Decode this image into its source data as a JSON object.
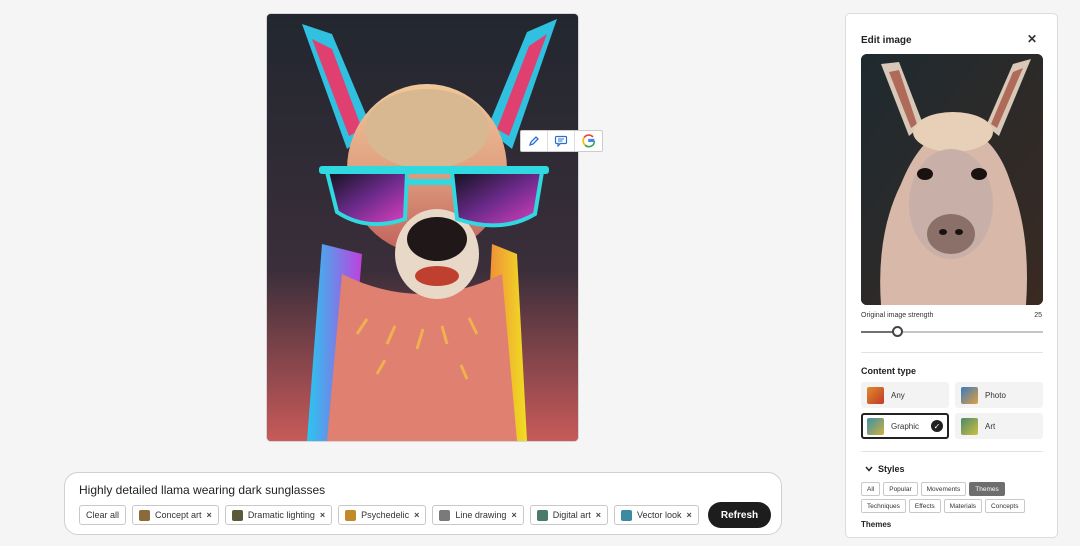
{
  "floating_toolbar": {
    "icons": [
      "pencil-icon",
      "comment-icon",
      "google-icon"
    ]
  },
  "prompt": {
    "text": "Highly detailed llama wearing dark sunglasses",
    "clear_label": "Clear all",
    "chips": [
      {
        "label": "Concept art",
        "thumb_color": "#8a6a3a"
      },
      {
        "label": "Dramatic lighting",
        "thumb_color": "#5a5a3a"
      },
      {
        "label": "Psychedelic",
        "thumb_color": "#c08a2a"
      },
      {
        "label": "Line drawing",
        "thumb_color": "#7a7a7a"
      },
      {
        "label": "Digital art",
        "thumb_color": "#4a7a6a"
      },
      {
        "label": "Vector look",
        "thumb_color": "#3a8aa0"
      }
    ],
    "refresh_label": "Refresh"
  },
  "panel": {
    "title": "Edit image",
    "strength_label": "Original image strength",
    "strength_value": "25",
    "strength_fraction": 0.2,
    "content_type_title": "Content type",
    "content_types": [
      {
        "label": "Any",
        "selected": false,
        "thumb_color": "#d06a2a"
      },
      {
        "label": "Photo",
        "selected": false,
        "thumb_color": "#3a7ac0"
      },
      {
        "label": "Graphic",
        "selected": true,
        "thumb_color": "#3a90a8"
      },
      {
        "label": "Art",
        "selected": false,
        "thumb_color": "#4a8a6a"
      }
    ],
    "styles_title": "Styles",
    "style_filters_row1": [
      {
        "label": "All",
        "active": false
      },
      {
        "label": "Popular",
        "active": false
      },
      {
        "label": "Movements",
        "active": false
      },
      {
        "label": "Themes",
        "active": true
      }
    ],
    "style_filters_row2": [
      {
        "label": "Techniques",
        "active": false
      },
      {
        "label": "Effects",
        "active": false
      },
      {
        "label": "Materials",
        "active": false
      },
      {
        "label": "Concepts",
        "active": false
      }
    ],
    "themes_title": "Themes"
  },
  "colors": {
    "accent_dark": "#1d1d1d",
    "active_filter": "#6e6e6e"
  }
}
